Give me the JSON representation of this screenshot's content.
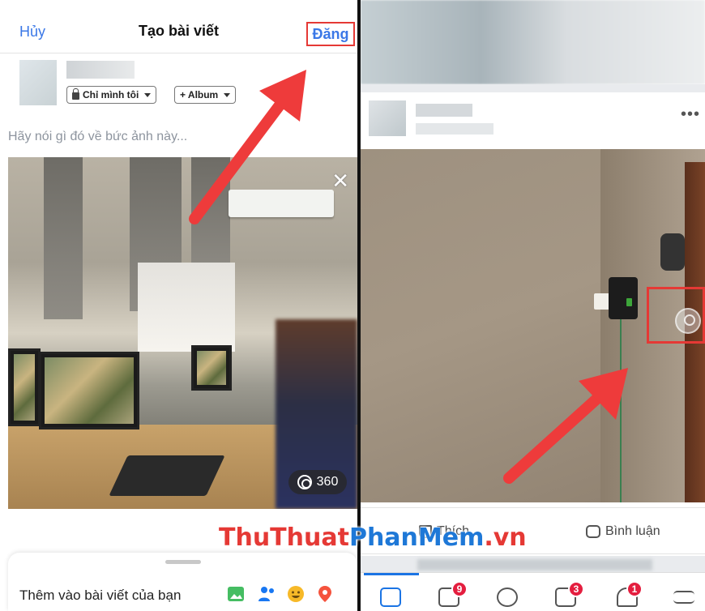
{
  "left": {
    "header": {
      "cancel_label": "Hủy",
      "title": "Tạo bài viết",
      "post_label": "Đăng"
    },
    "audience": {
      "privacy_label": "Chỉ mình tôi",
      "album_label": "+ Album"
    },
    "placeholder": "Hãy nói gì đó về bức ảnh này...",
    "photo": {
      "badge": "360",
      "close_glyph": "✕"
    },
    "bottom_sheet": {
      "label": "Thêm vào bài viết của bạn",
      "icons": [
        "photo-icon",
        "tag-people-icon",
        "feeling-icon",
        "location-icon"
      ]
    }
  },
  "right": {
    "more_glyph": "•••",
    "actions": {
      "like_label": "Thích",
      "comment_label": "Bình luận"
    },
    "tabbar": {
      "tabs": [
        "news-feed-tab",
        "watch-tab",
        "profile-tab",
        "pages-tab",
        "notifications-tab",
        "menu-tab"
      ],
      "badges": {
        "watch": "9",
        "pages": "3",
        "notifications": "1"
      }
    }
  },
  "watermark": {
    "part1": "ThuThuat",
    "part2": "PhanMem",
    "part3": ".vn"
  },
  "colors": {
    "accent": "#3b78e7",
    "highlight": "#e53935",
    "badge": "#e41e3f"
  }
}
